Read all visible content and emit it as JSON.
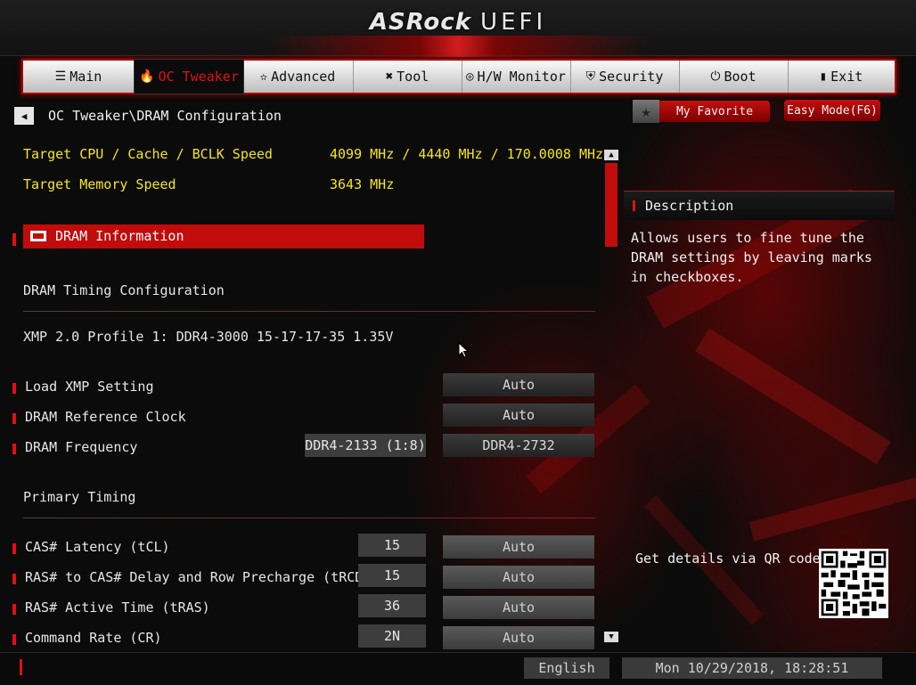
{
  "header": {
    "brand": "ASRock",
    "product": "UEFI"
  },
  "nav": {
    "tabs": [
      {
        "label": "Main",
        "icon": "list-icon",
        "glyph": "☰",
        "active": false
      },
      {
        "label": "OC Tweaker",
        "icon": "flame-icon",
        "glyph": "🔥",
        "active": true
      },
      {
        "label": "Advanced",
        "icon": "star-icon",
        "glyph": "✫",
        "active": false
      },
      {
        "label": "Tool",
        "icon": "tools-icon",
        "glyph": "✖",
        "active": false
      },
      {
        "label": "H/W Monitor",
        "icon": "monitor-icon",
        "glyph": "◎",
        "active": false
      },
      {
        "label": "Security",
        "icon": "shield-icon",
        "glyph": "⛨",
        "active": false
      },
      {
        "label": "Boot",
        "icon": "power-icon",
        "glyph": "⏻",
        "active": false
      },
      {
        "label": "Exit",
        "icon": "exit-icon",
        "glyph": "▮",
        "active": false
      }
    ]
  },
  "breadcrumb": {
    "back_glyph": "◀",
    "path": "OC Tweaker\\DRAM Configuration"
  },
  "buttons": {
    "favorite": "My Favorite",
    "favorite_glyph": "★",
    "easy_mode": "Easy Mode(F6)"
  },
  "info": {
    "cpu_label": "Target CPU / Cache / BCLK Speed",
    "cpu_value": "4099 MHz / 4440 MHz / 170.0008 MHz",
    "mem_label": "Target Memory Speed",
    "mem_value": "3643 MHz"
  },
  "dram_info": "DRAM Information",
  "section_timing_config": "DRAM Timing Configuration",
  "xmp_profile": "XMP 2.0 Profile 1: DDR4-3000 15-17-17-35 1.35V",
  "settings": {
    "load_xmp": {
      "label": "Load XMP Setting",
      "value": "Auto"
    },
    "ref_clock": {
      "label": "DRAM Reference Clock",
      "value": "Auto"
    },
    "frequency": {
      "label": "DRAM Frequency",
      "current": "DDR4-2133 (1:8)",
      "value": "DDR4-2732"
    }
  },
  "section_primary": "Primary Timing",
  "timings": [
    {
      "label": "CAS# Latency (tCL)",
      "current": "15",
      "value": "Auto"
    },
    {
      "label": "RAS# to CAS# Delay and Row Precharge (tRCDtRP)",
      "current": "15",
      "value": "Auto"
    },
    {
      "label": "RAS# Active Time (tRAS)",
      "current": "36",
      "value": "Auto"
    },
    {
      "label": "Command Rate (CR)",
      "current": "2N",
      "value": "Auto"
    }
  ],
  "scrollbar": {
    "up_glyph": "▲",
    "down_glyph": "▼"
  },
  "description": {
    "title": "Description",
    "body": "Allows users to fine tune the DRAM settings by leaving marks in checkboxes."
  },
  "qr": {
    "label": "Get details via QR code"
  },
  "footer": {
    "language": "English",
    "datetime": "Mon 10/29/2018, 18:28:51"
  },
  "colors": {
    "accent": "#c20b0b",
    "highlight_text": "#f5e619"
  }
}
